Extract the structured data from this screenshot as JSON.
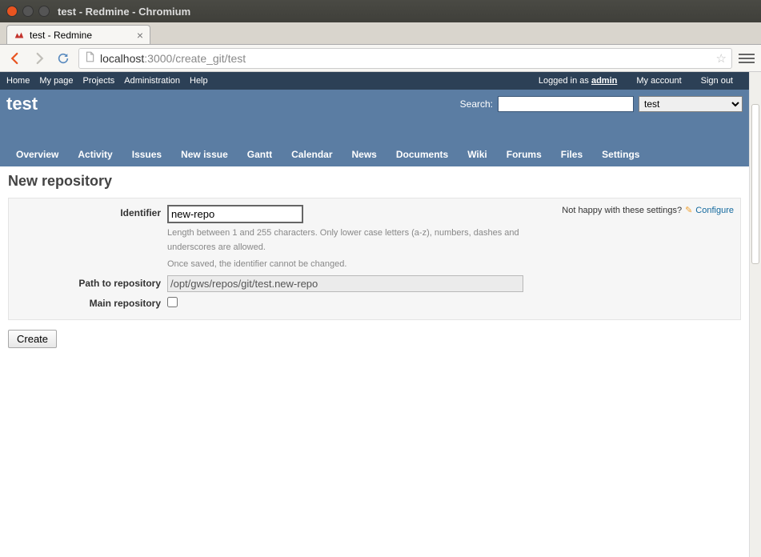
{
  "window": {
    "title": "test - Redmine - Chromium"
  },
  "tab": {
    "title": "test - Redmine"
  },
  "url": {
    "host": "localhost",
    "port": ":3000",
    "path": "/create_git/test"
  },
  "top_menu": {
    "left": [
      "Home",
      "My page",
      "Projects",
      "Administration",
      "Help"
    ],
    "logged_prefix": "Logged in as ",
    "logged_user": "admin",
    "right": [
      "My account",
      "Sign out"
    ]
  },
  "header": {
    "title": "test",
    "search_label": "Search:",
    "search_value": "",
    "project_select": "test"
  },
  "main_menu": [
    "Overview",
    "Activity",
    "Issues",
    "New issue",
    "Gantt",
    "Calendar",
    "News",
    "Documents",
    "Wiki",
    "Forums",
    "Files",
    "Settings"
  ],
  "content": {
    "heading": "New repository",
    "contextual_text": "Not happy with these settings?",
    "configure_link": "Configure",
    "fields": {
      "identifier_label": "Identifier",
      "identifier_value": "new-repo",
      "identifier_hint1": "Length between 1 and 255 characters. Only lower case letters (a-z), numbers, dashes and underscores are allowed.",
      "identifier_hint2": "Once saved, the identifier cannot be changed.",
      "path_label": "Path to repository",
      "path_value": "/opt/gws/repos/git/test.new-repo",
      "main_repo_label": "Main repository"
    },
    "create_button": "Create"
  }
}
